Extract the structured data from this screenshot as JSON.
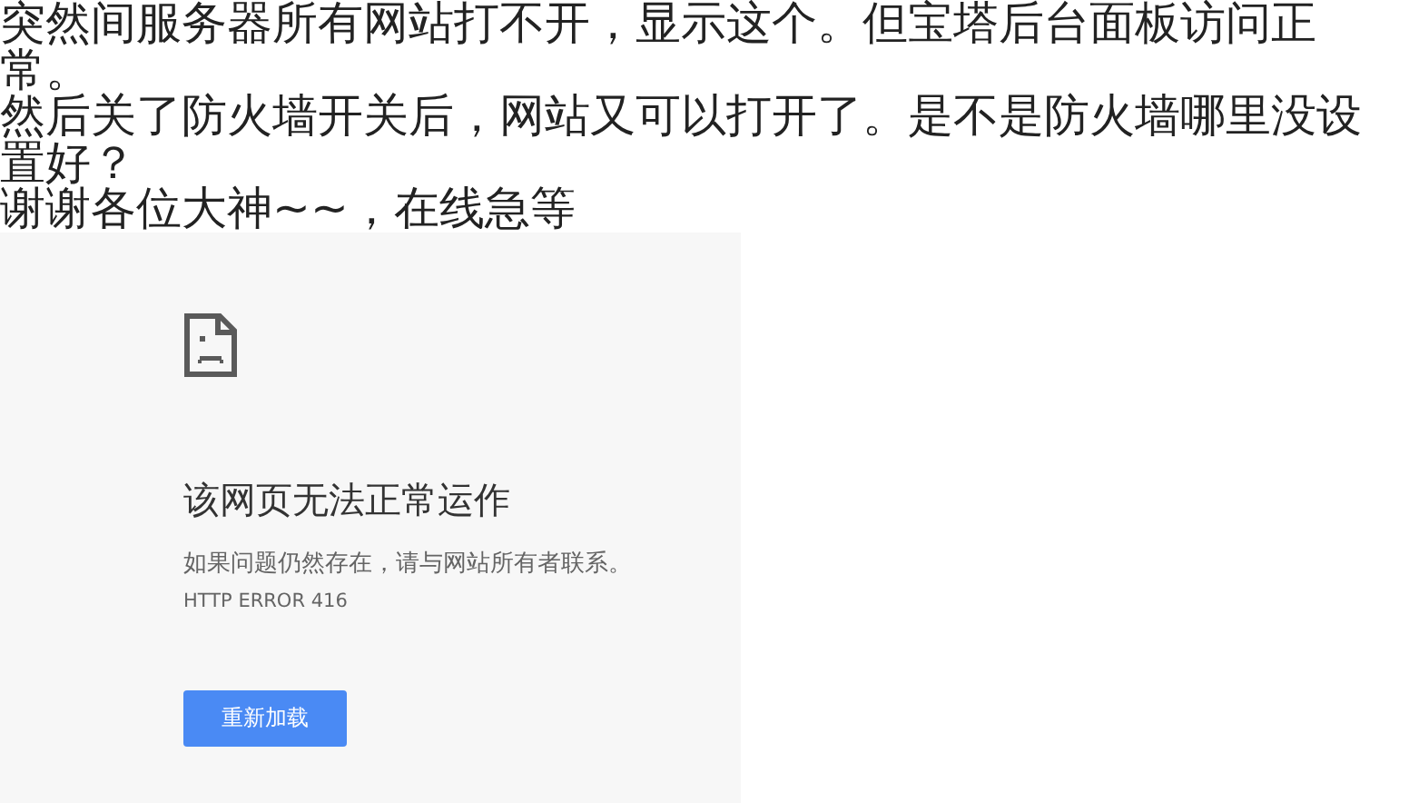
{
  "post": {
    "paragraphs": [
      "突然间服务器所有网站打不开，显示这个。但宝塔后台面板访问正常。",
      "然后关了防火墙开关后，网站又可以打开了。是不是防火墙哪里没设置好？",
      "谢谢各位大神~~，在线急等"
    ]
  },
  "error_page": {
    "title": "该网页无法正常运作",
    "message": "如果问题仍然存在，请与网站所有者联系。",
    "code": "HTTP ERROR 416",
    "button": "重新加载"
  }
}
